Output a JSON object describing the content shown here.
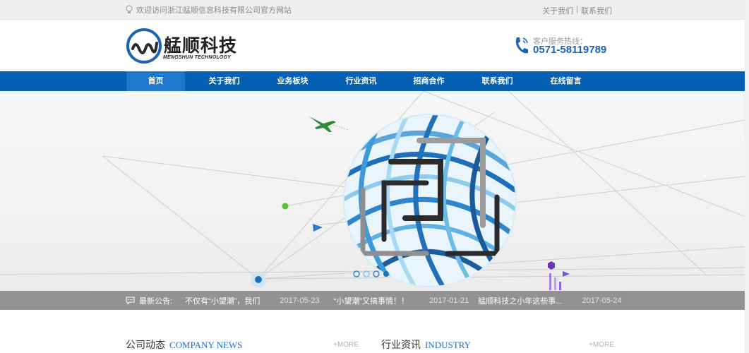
{
  "topbar": {
    "welcome": "欢迎访问浙江艋顺信息科技有限公司官方网站",
    "about_link": "关于我们",
    "separator": "|",
    "contact_link": "联系我们"
  },
  "logo": {
    "title": "艋顺科技",
    "subtitle": "MENGSHUN TECHNOLOGY"
  },
  "hotline": {
    "label": "客户服务热线：",
    "number": "0571-58119789"
  },
  "nav": {
    "items": [
      {
        "label": "首页",
        "active": true
      },
      {
        "label": "关于我们"
      },
      {
        "label": "业务板块"
      },
      {
        "label": "行业资讯"
      },
      {
        "label": "招商合作"
      },
      {
        "label": "联系我们"
      },
      {
        "label": "在线留言"
      }
    ]
  },
  "notice": {
    "title": "最新公告:",
    "items": [
      {
        "text": "不仅有“小望潮”，我们",
        "date": "2017-05-23"
      },
      {
        "text": "“小望潮”又搞事情！！",
        "date": "2017-01-21"
      },
      {
        "text": "艋顺科技之小年这些事...",
        "date": "2017-05-24"
      }
    ]
  },
  "sections": [
    {
      "cn": "公司动态",
      "en": "COMPANY NEWS",
      "more": "+MORE"
    },
    {
      "cn": "行业资讯",
      "en": "INDUSTRY",
      "more": "+MORE"
    }
  ],
  "colors": {
    "nav_bg": "#0561b3",
    "nav_active": "#1c78cd",
    "accent": "#1d62b3"
  }
}
